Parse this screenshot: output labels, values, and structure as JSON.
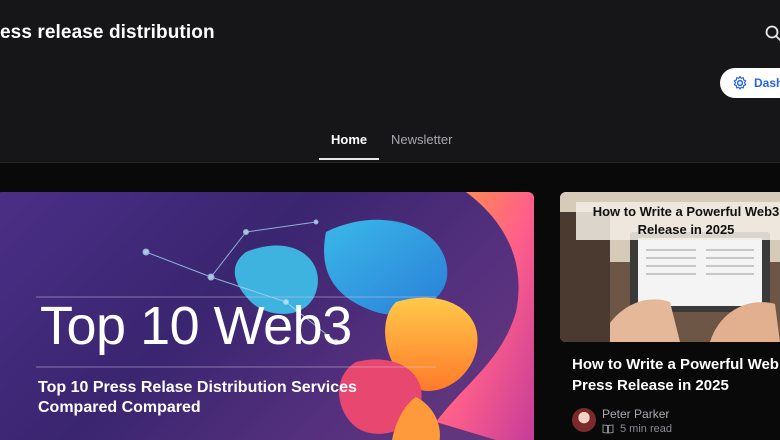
{
  "header": {
    "site_title": "ess release distribution",
    "search_icon": "search-icon",
    "dashboard_label": "Dash",
    "dashboard_icon": "gear-icon"
  },
  "nav": {
    "tabs": [
      {
        "label": "Home",
        "active": true
      },
      {
        "label": "Newsletter",
        "active": false
      }
    ]
  },
  "featured": {
    "image_headline": "Top 10 Web3",
    "image_subtitle": "Top 10 Press Relase Distribution Services Compared Compared"
  },
  "side_article": {
    "image_caption": "How to Write a Powerful Web3 Release in 2025",
    "title": "How to Write a Powerful Web Press Release in 2025",
    "author": "Peter Parker",
    "read_time": "5 min read"
  },
  "colors": {
    "background": "#161618",
    "accent": "#2563eb"
  }
}
